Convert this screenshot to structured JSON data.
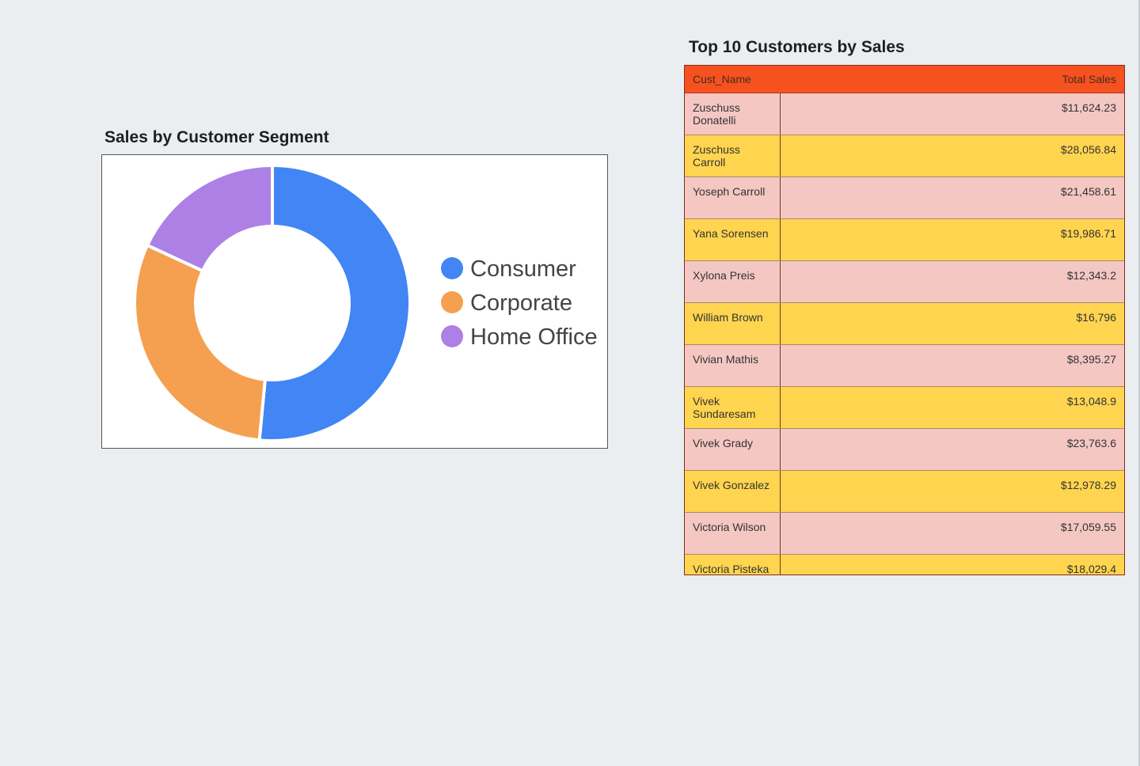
{
  "chart_data": {
    "type": "pie",
    "title": "Sales by Customer Segment",
    "categories": [
      "Consumer",
      "Corporate",
      "Home Office"
    ],
    "values": [
      51.5,
      30.4,
      18.1
    ],
    "colors": [
      "#4285f4",
      "#f4a050",
      "#ad80e6"
    ],
    "legend": "right",
    "donut": true
  },
  "table": {
    "title": "Top 10 Customers by Sales",
    "columns": [
      "Cust_Name",
      "Total Sales"
    ],
    "rows": [
      {
        "name": "Zuschuss Donatelli",
        "sales": "$11,624.23"
      },
      {
        "name": "Zuschuss Carroll",
        "sales": "$28,056.84"
      },
      {
        "name": "Yoseph Carroll",
        "sales": "$21,458.61"
      },
      {
        "name": "Yana Sorensen",
        "sales": "$19,986.71"
      },
      {
        "name": "Xylona Preis",
        "sales": "$12,343.2"
      },
      {
        "name": "William Brown",
        "sales": "$16,796"
      },
      {
        "name": "Vivian Mathis",
        "sales": "$8,395.27"
      },
      {
        "name": "Vivek Sundaresam",
        "sales": "$13,048.9"
      },
      {
        "name": "Vivek Grady",
        "sales": "$23,763.6"
      },
      {
        "name": "Vivek Gonzalez",
        "sales": "$12,978.29"
      },
      {
        "name": "Victoria Wilson",
        "sales": "$17,059.55"
      },
      {
        "name": "Victoria Pisteka",
        "sales": "$18,029.4"
      }
    ],
    "colors": {
      "header": "#f55220",
      "row_odd": "#f4c7c3",
      "row_even": "#ffd54f"
    }
  }
}
